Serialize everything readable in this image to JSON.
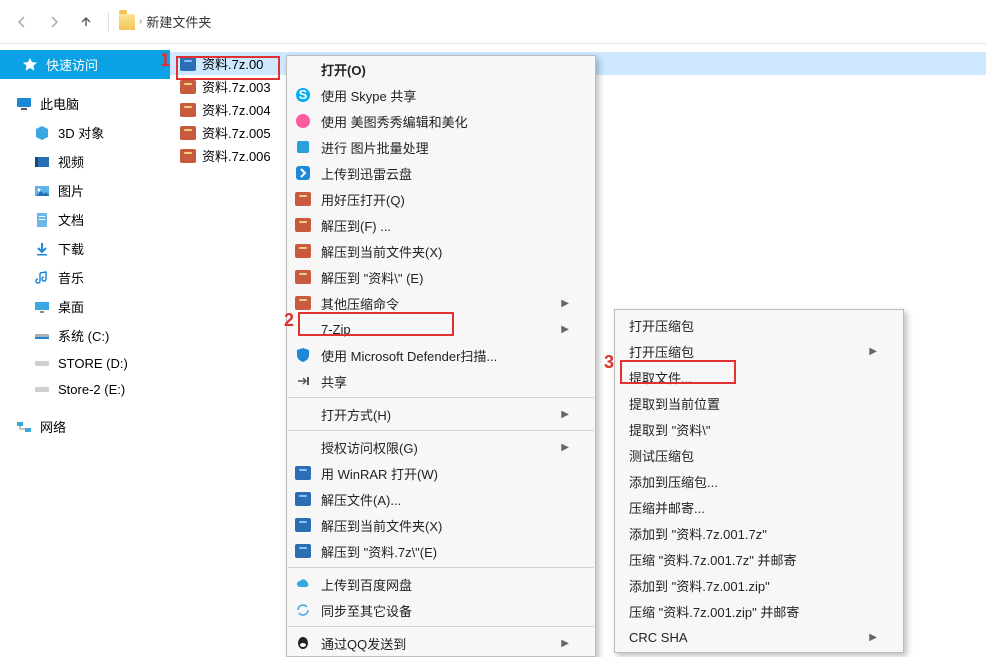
{
  "annotations": {
    "n1": "1",
    "n2": "2",
    "n3": "3"
  },
  "breadcrumb": {
    "sep": "›",
    "folder": "新建文件夹"
  },
  "sidebar": {
    "quick_access": "快速访问",
    "this_pc": "此电脑",
    "children": [
      "3D 对象",
      "视频",
      "图片",
      "文档",
      "下载",
      "音乐",
      "桌面",
      "系统 (C:)",
      "STORE (D:)",
      "Store-2 (E:)"
    ],
    "network": "网络"
  },
  "files": [
    "资料.7z.00",
    "资料.7z.003",
    "资料.7z.004",
    "资料.7z.005",
    "资料.7z.006"
  ],
  "menu": {
    "open": "打开(O)",
    "skype": "使用 Skype 共享",
    "meitu": "使用 美图秀秀编辑和美化",
    "batch": "进行 图片批量处理",
    "xunlei": "上传到迅雷云盘",
    "haozip_open": "用好压打开(Q)",
    "extract_to_f": "解压到(F) ...",
    "extract_here_x": "解压到当前文件夹(X)",
    "extract_to_ziliao_e": "解压到 \"资料\\\" (E)",
    "other_compress": "其他压缩命令",
    "seven_zip": "7-Zip",
    "defender": "使用 Microsoft Defender扫描...",
    "share": "共享",
    "open_with": "打开方式(H)",
    "grant_access": "授权访问权限(G)",
    "winrar_open": "用 WinRAR 打开(W)",
    "rar_extract_a": "解压文件(A)...",
    "rar_extract_here": "解压到当前文件夹(X)",
    "rar_extract_to": "解压到 \"资料.7z\\\"(E)",
    "baidu": "上传到百度网盘",
    "sync": "同步至其它设备",
    "qq": "通过QQ发送到"
  },
  "submenu": {
    "open_archive_1": "打开压缩包",
    "open_archive_2": "打开压缩包",
    "extract_files": "提取文件...",
    "extract_here": "提取到当前位置",
    "extract_to_folder": "提取到 \"资料\\\"",
    "test_archive": "测试压缩包",
    "add_to_archive": "添加到压缩包...",
    "compress_mail": "压缩并邮寄...",
    "add_to_7z": "添加到 \"资料.7z.001.7z\"",
    "compress_7z_mail": "压缩 \"资料.7z.001.7z\" 并邮寄",
    "add_to_zip": "添加到 \"资料.7z.001.zip\"",
    "compress_zip_mail": "压缩 \"资料.7z.001.zip\" 并邮寄",
    "crc_sha": "CRC SHA"
  }
}
